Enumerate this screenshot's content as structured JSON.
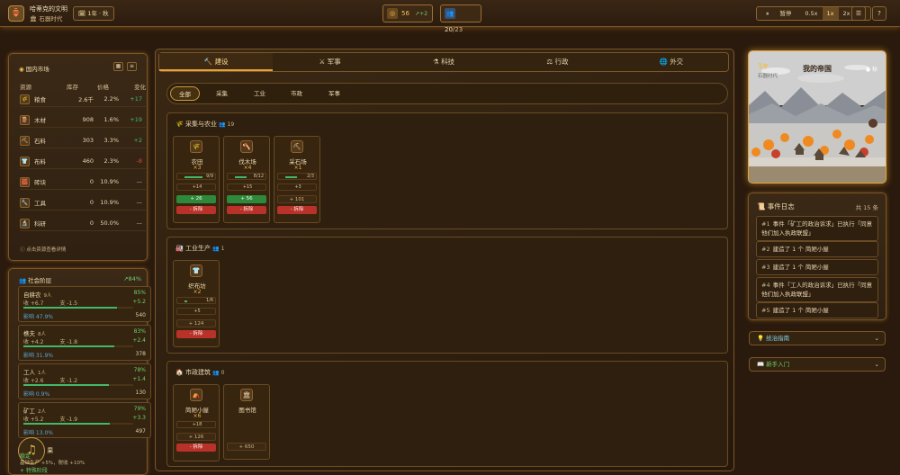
{
  "topbar": {
    "civ_name": "哈蒂克的文明",
    "era": "石器时代",
    "date": "1年 · 秋",
    "res1_value": "56",
    "res1_rate": "+2",
    "res2_value": "20",
    "res2_max": "/23",
    "pause_label": "暂停",
    "speeds": [
      "0.5x",
      "1x",
      "2x",
      "5x"
    ],
    "active_speed": "1x"
  },
  "market": {
    "title": "国内市场",
    "headers": [
      "资源",
      "库存",
      "价格",
      "变化"
    ],
    "rows": [
      {
        "icon": "🌾",
        "name": "粮食",
        "stock": "2.6千",
        "price": "2.2%",
        "change": "+17"
      },
      {
        "icon": "🪵",
        "name": "木材",
        "stock": "908",
        "price": "1.6%",
        "change": "+19"
      },
      {
        "icon": "⛏",
        "name": "石料",
        "stock": "303",
        "price": "3.3%",
        "change": "+2"
      },
      {
        "icon": "👕",
        "name": "布料",
        "stock": "460",
        "price": "2.3%",
        "change": "-8"
      },
      {
        "icon": "🧱",
        "name": "砖块",
        "stock": "0",
        "price": "10.9%",
        "change": "—"
      },
      {
        "icon": "🔧",
        "name": "工具",
        "stock": "0",
        "price": "10.9%",
        "change": "—"
      },
      {
        "icon": "🔬",
        "name": "科研",
        "stock": "0",
        "price": "50.0%",
        "change": "—"
      }
    ],
    "hint": "点击资源查看详情"
  },
  "social": {
    "title": "社会阶层",
    "overall": "84%",
    "classes": [
      {
        "name": "自耕农",
        "count": "9人",
        "pct": "85%",
        "fill": 0.85,
        "c1": "收 +6.7",
        "c2": "支 -1.5",
        "c3": "+5.2",
        "inf": "影响 47.9%",
        "val": "540"
      },
      {
        "name": "樵夫",
        "count": "8人",
        "pct": "83%",
        "fill": 0.83,
        "c1": "收 +4.2",
        "c2": "支 -1.8",
        "c3": "+2.4",
        "inf": "影响 31.9%",
        "val": "378"
      },
      {
        "name": "工人",
        "count": "1人",
        "pct": "78%",
        "fill": 0.78,
        "c1": "收 +2.6",
        "c2": "支 -1.2",
        "c3": "+1.4",
        "inf": "影响 0.9%",
        "val": "130"
      },
      {
        "name": "矿工",
        "count": "2人",
        "pct": "79%",
        "fill": 0.79,
        "c1": "收 +5.2",
        "c2": "支 -1.9",
        "c3": "+3.3",
        "inf": "影响 13.0%",
        "val": "497"
      }
    ],
    "footer_title": "果",
    "footer_line1": "稳定",
    "footer_line2": "基础生产 +5%，税收 +10%",
    "footer_line3": "+ 特殊阶段"
  },
  "tabs": [
    "建设",
    "军事",
    "科技",
    "行政",
    "外交"
  ],
  "subtabs": [
    "全部",
    "采集",
    "工业",
    "市政",
    "军事"
  ],
  "sections": [
    {
      "title": "采集与农业",
      "workers": "19",
      "cards": [
        {
          "icon": "🌾",
          "name": "农田",
          "count": "×3",
          "s1": "9/9",
          "s1fill": 1.0,
          "s2": "+14",
          "buy": "+ 26",
          "sell": "- 拆除"
        },
        {
          "icon": "🪓",
          "name": "伐木场",
          "count": "×4",
          "s1": "8/12",
          "s1fill": 0.67,
          "s2": "+15",
          "buy": "+ 56",
          "sell": "- 拆除"
        },
        {
          "icon": "⛏",
          "name": "采石场",
          "count": "×1",
          "s1": "2/3",
          "s1fill": 0.67,
          "s2": "+3",
          "buy": "+ 101",
          "sell": "- 拆除"
        }
      ]
    },
    {
      "title": "工业生产",
      "workers": "1",
      "cards": [
        {
          "icon": "👕",
          "name": "织布坊",
          "count": "×2",
          "s1": "1/6",
          "s1fill": 0.17,
          "s2": "+5",
          "buy": "+ 124",
          "sell": "- 拆除"
        }
      ]
    },
    {
      "title": "市政建筑",
      "workers": "0",
      "cards": [
        {
          "icon": "⛺",
          "name": "简陋小屋",
          "count": "×6",
          "s2": "+18",
          "buy": "+ 126",
          "sell": "- 拆除"
        },
        {
          "icon": "🏛",
          "name": "图书馆",
          "buy": "+ 650"
        }
      ]
    }
  ],
  "empire": {
    "year": "1",
    "year_unit": "年",
    "era": "石器时代",
    "title": "我的帝国",
    "season": "秋"
  },
  "log": {
    "title": "事件日志",
    "count": "共 15 条",
    "items": [
      {
        "n": "#1",
        "text": "事件「矿工的政治诉求」已执行「同意他们加入执政联盟」"
      },
      {
        "n": "#2",
        "text": "建造了 1 个 简陋小屋"
      },
      {
        "n": "#3",
        "text": "建造了 1 个 简陋小屋"
      },
      {
        "n": "#4",
        "text": "事件「工人的政治诉求」已执行「同意他们加入执政联盟」"
      },
      {
        "n": "#5",
        "text": "建造了 1 个 简陋小屋"
      }
    ]
  },
  "guide": {
    "rule_label": "统治指南",
    "newbie_label": "新手入门"
  },
  "colors": {
    "accent": "#e7a33a",
    "positive": "#44b86a",
    "negative": "#d04a3a",
    "bg": "#2a1a0d"
  }
}
